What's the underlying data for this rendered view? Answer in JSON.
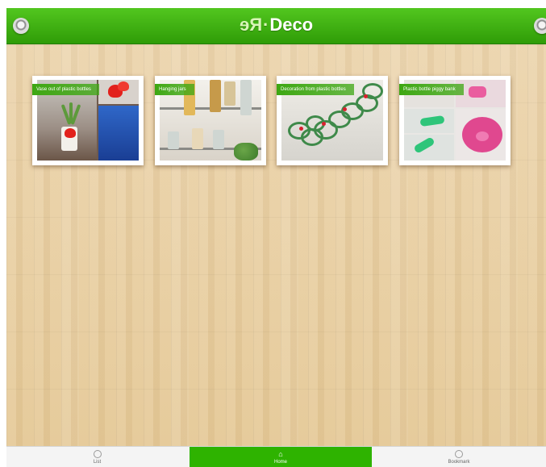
{
  "header": {
    "title_prefix": "Re",
    "title_separator": "·",
    "title_main": "Deco",
    "left_button_icon": "circle-icon",
    "right_button_icon": "circle-icon",
    "bar_color": "#3aa90f"
  },
  "projects": [
    {
      "label": "Vase out of plastic bottles",
      "image": "vase-with-hearts"
    },
    {
      "label": "Hanging jars",
      "image": "jars-on-shelf"
    },
    {
      "label": "Decoration from plastic bottles",
      "image": "green-rings-garland"
    },
    {
      "label": "Plastic bottle piggy bank",
      "image": "pink-piggy-bank"
    }
  ],
  "tabbar": {
    "tabs": [
      {
        "label": "List",
        "icon": "list-icon",
        "selected": false
      },
      {
        "label": "Home",
        "icon": "home-icon",
        "selected": true
      },
      {
        "label": "Bookmark",
        "icon": "bookmark-icon",
        "selected": false
      }
    ],
    "selected_color": "#2eb300"
  }
}
